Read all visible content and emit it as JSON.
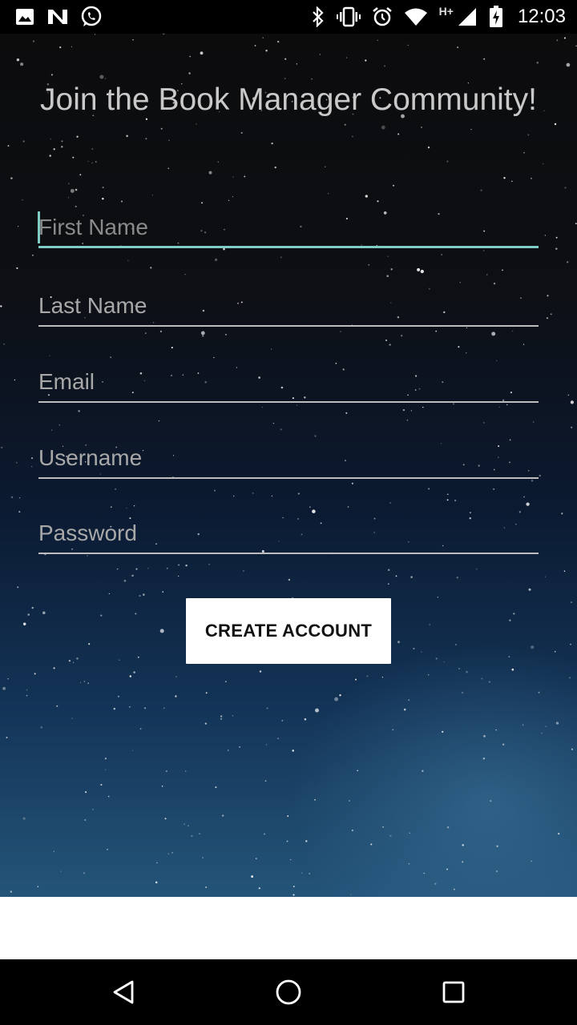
{
  "status_bar": {
    "left_icons": [
      "image-icon",
      "n-app-icon",
      "whatsapp-icon"
    ],
    "right_icons": [
      "bluetooth-icon",
      "vibrate-icon",
      "alarm-icon",
      "wifi-icon",
      "signal-icon",
      "battery-charging-icon"
    ],
    "network_type": "H+",
    "time": "12:03"
  },
  "signup": {
    "title": "Join the Book Manager Community!",
    "fields": [
      {
        "label": "First Name",
        "focused": true
      },
      {
        "label": "Last Name",
        "focused": false
      },
      {
        "label": "Email",
        "focused": false
      },
      {
        "label": "Username",
        "focused": false
      },
      {
        "label": "Password",
        "focused": false
      }
    ],
    "create_button": "CREATE ACCOUNT"
  },
  "colors": {
    "accent": "#80cbc4",
    "button_bg": "#ffffff",
    "hint_text": "#a8a8a8"
  },
  "nav_bar": {
    "buttons": [
      "back-icon",
      "home-icon",
      "recents-icon"
    ]
  }
}
